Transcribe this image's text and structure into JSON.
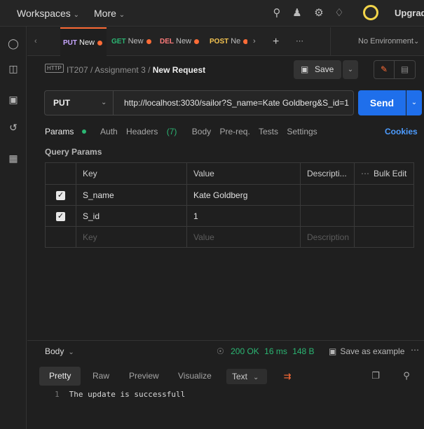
{
  "topbar": {
    "workspaces": "Workspaces",
    "more": "More",
    "upgrade": "Upgrade"
  },
  "tabs": [
    {
      "method": "PUT",
      "name": "New",
      "method_color": "#c7a6ff"
    },
    {
      "method": "GET",
      "name": "New",
      "method_color": "#2bb673"
    },
    {
      "method": "DEL",
      "name": "New",
      "method_color": "#ff7b7b"
    },
    {
      "method": "POST",
      "name": "Ne",
      "method_color": "#f5c451"
    }
  ],
  "environment": "No Environment",
  "breadcrumb": {
    "icon_text": "HTTP",
    "collection": "IT207",
    "folder": "Assignment 3",
    "request": "New Request"
  },
  "save_label": "Save",
  "request": {
    "method": "PUT",
    "url": "http://localhost:3030/sailor?S_name=Kate Goldberg&S_id=1",
    "send_label": "Send"
  },
  "request_tabs": {
    "params": "Params",
    "auth": "Auth",
    "headers": "Headers",
    "headers_count": "(7)",
    "body": "Body",
    "prereq": "Pre-req.",
    "tests": "Tests",
    "settings": "Settings",
    "cookies": "Cookies"
  },
  "query_params": {
    "title": "Query Params",
    "columns": {
      "key": "Key",
      "value": "Value",
      "description": "Descripti...",
      "bulk_edit": "Bulk Edit"
    },
    "rows": [
      {
        "key": "S_name",
        "value": "Kate Goldberg",
        "checked": true
      },
      {
        "key": "S_id",
        "value": "1",
        "checked": true
      }
    ],
    "placeholders": {
      "key": "Key",
      "value": "Value",
      "description": "Description"
    }
  },
  "response": {
    "label": "Body",
    "status": "200 OK",
    "time": "16 ms",
    "size": "148 B",
    "save_example": "Save as example",
    "view_tabs": [
      "Pretty",
      "Raw",
      "Preview",
      "Visualize"
    ],
    "format": "Text",
    "lines": [
      "The update is successfull"
    ]
  },
  "colors": {
    "accent": "#ff6c37",
    "send": "#1f6feb",
    "success": "#2bb673",
    "link": "#4d9cff"
  }
}
